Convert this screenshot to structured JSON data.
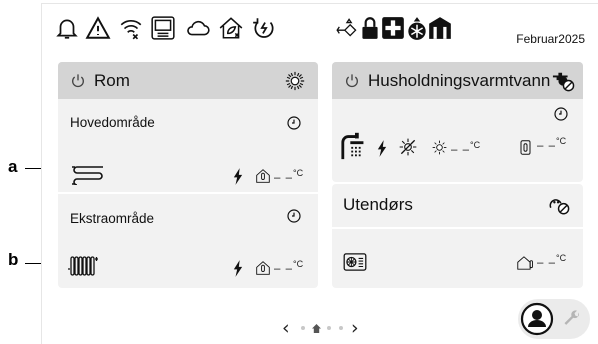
{
  "callouts": {
    "a": "a",
    "b": "b"
  },
  "status_bar": {
    "icons": [
      "bell-icon",
      "warning-icon",
      "wifi-off-icon",
      "router-icon",
      "cloud-icon",
      "eco-house-off-icon",
      "power-mode-icon",
      "network-icon",
      "lock-icon",
      "medical-cross-icon",
      "defrost-icon",
      "building-icon"
    ],
    "date": "Februar2025"
  },
  "room_card": {
    "title": "Rom",
    "header_icon": "sun-icon",
    "zones": [
      {
        "label": "Hovedområde",
        "emitter_icon": "underfloor-heating-icon",
        "temp": "– –",
        "unit": "°C"
      },
      {
        "label": "Ekstraområde",
        "emitter_icon": "radiator-icon",
        "temp": "– –",
        "unit": "°C"
      }
    ]
  },
  "dhw_card": {
    "title": "Husholdningsvarmtvann",
    "header_icon": "tap-off-icon",
    "temp_left": "– –",
    "temp_right": "– –",
    "unit": "°C"
  },
  "outdoor_card": {
    "title": "Utendørs",
    "header_icon": "outdoor-unit-off-icon",
    "temp": "– –",
    "unit": "°C"
  },
  "navigation": {
    "prev": "‹",
    "next": "›",
    "pages": 4,
    "current_page": 2
  },
  "colors": {
    "header_bg": "#d4d4d4",
    "card_bg": "#f2f2f2",
    "text": "#111111",
    "accent_dark": "#000000"
  }
}
